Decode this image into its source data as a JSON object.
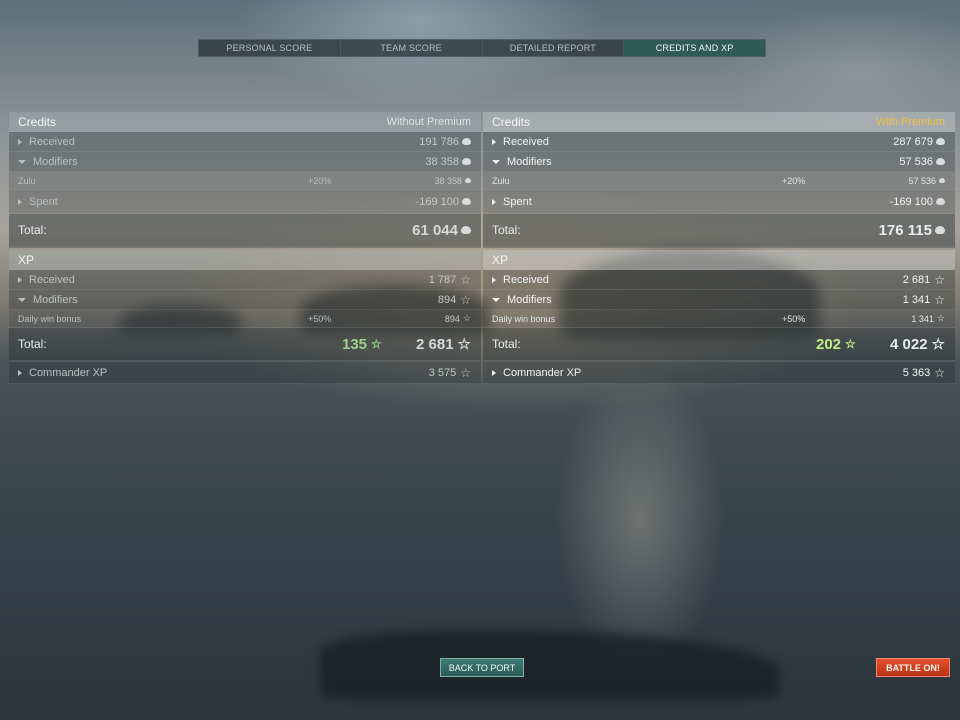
{
  "tabs": [
    {
      "label": "PERSONAL SCORE"
    },
    {
      "label": "TEAM SCORE"
    },
    {
      "label": "DETAILED REPORT"
    },
    {
      "label": "CREDITS AND XP"
    }
  ],
  "active_tab": "CREDITS AND XP",
  "colors": {
    "premium_accent": "#f0c040",
    "xp_bonus_left": "#9ccf8c",
    "xp_bonus_right": "#c2ee86",
    "battle_button": "#d2401f",
    "port_button": "#3a6f6a"
  },
  "left": {
    "credits": {
      "title": "Credits",
      "mode": "Without Premium",
      "received": {
        "label": "Received",
        "value": "191 786"
      },
      "modifiers": {
        "label": "Modifiers",
        "value": "38 358"
      },
      "modifier_detail": {
        "label": "Zulu",
        "pct": "+20%",
        "value": "38 358"
      },
      "spent": {
        "label": "Spent",
        "value": "-169 100"
      },
      "total": {
        "label": "Total:",
        "value": "61 044"
      }
    },
    "xp": {
      "title": "XP",
      "received": {
        "label": "Received",
        "value": "1 787"
      },
      "modifiers": {
        "label": "Modifiers",
        "value": "894"
      },
      "modifier_detail": {
        "label": "Daily win bonus",
        "pct": "+50%",
        "value": "894"
      },
      "total": {
        "label": "Total:",
        "bonus": "135",
        "value": "2 681"
      },
      "commander": {
        "label": "Commander XP",
        "value": "3 575"
      }
    }
  },
  "right": {
    "credits": {
      "title": "Credits",
      "mode": "With Premium",
      "received": {
        "label": "Received",
        "value": "287 679"
      },
      "modifiers": {
        "label": "Modifiers",
        "value": "57 536"
      },
      "modifier_detail": {
        "label": "Zulu",
        "pct": "+20%",
        "value": "57 536"
      },
      "spent": {
        "label": "Spent",
        "value": "-169 100"
      },
      "total": {
        "label": "Total:",
        "value": "176 115"
      }
    },
    "xp": {
      "title": "XP",
      "received": {
        "label": "Received",
        "value": "2 681"
      },
      "modifiers": {
        "label": "Modifiers",
        "value": "1 341"
      },
      "modifier_detail": {
        "label": "Daily win bonus",
        "pct": "+50%",
        "value": "1 341"
      },
      "total": {
        "label": "Total:",
        "bonus": "202",
        "value": "4 022"
      },
      "commander": {
        "label": "Commander XP",
        "value": "5 363"
      }
    }
  },
  "buttons": {
    "back_to_port": "BACK TO PORT",
    "battle_on": "BATTLE ON!"
  },
  "icons": {
    "credit": "credit-icon",
    "xp": "star-icon",
    "expand": "arrow-right-icon",
    "collapse": "arrow-down-icon"
  }
}
